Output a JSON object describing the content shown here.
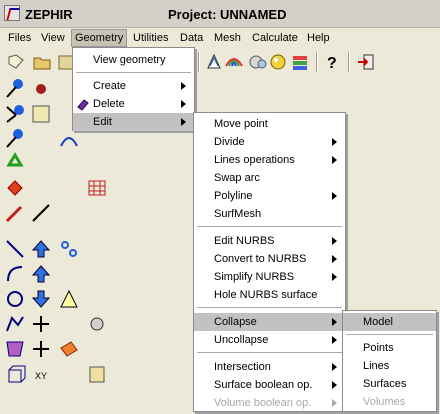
{
  "app": {
    "name": "ZEPHIR",
    "window_title": "Project: UNNAMED"
  },
  "menubar": [
    {
      "label": "Files"
    },
    {
      "label": "View"
    },
    {
      "label": "Geometry"
    },
    {
      "label": "Utilities"
    },
    {
      "label": "Data"
    },
    {
      "label": "Mesh"
    },
    {
      "label": "Calculate"
    },
    {
      "label": "Help"
    }
  ],
  "geometry_menu": {
    "items": [
      "View geometry",
      "Create",
      "Delete",
      "Edit"
    ]
  },
  "edit_menu": {
    "items": [
      "Move point",
      "Divide",
      "Lines operations",
      "Swap arc",
      "Polyline",
      "SurfMesh",
      "Edit NURBS",
      "Convert to NURBS",
      "Simplify NURBS",
      "Hole NURBS surface",
      "Collapse",
      "Uncollapse",
      "Intersection",
      "Surface boolean op.",
      "Volume boolean op."
    ]
  },
  "collapse_menu": {
    "items": [
      "Model",
      "Points",
      "Lines",
      "Surfaces",
      "Volumes"
    ]
  },
  "icons": {
    "toolbar": [
      "new-file-icon",
      "open-folder-icon",
      "save-icon",
      "print-icon",
      "rainbow-icon",
      "render-icon",
      "color-icon",
      "layers-icon",
      "help-icon",
      "exit-icon"
    ]
  }
}
